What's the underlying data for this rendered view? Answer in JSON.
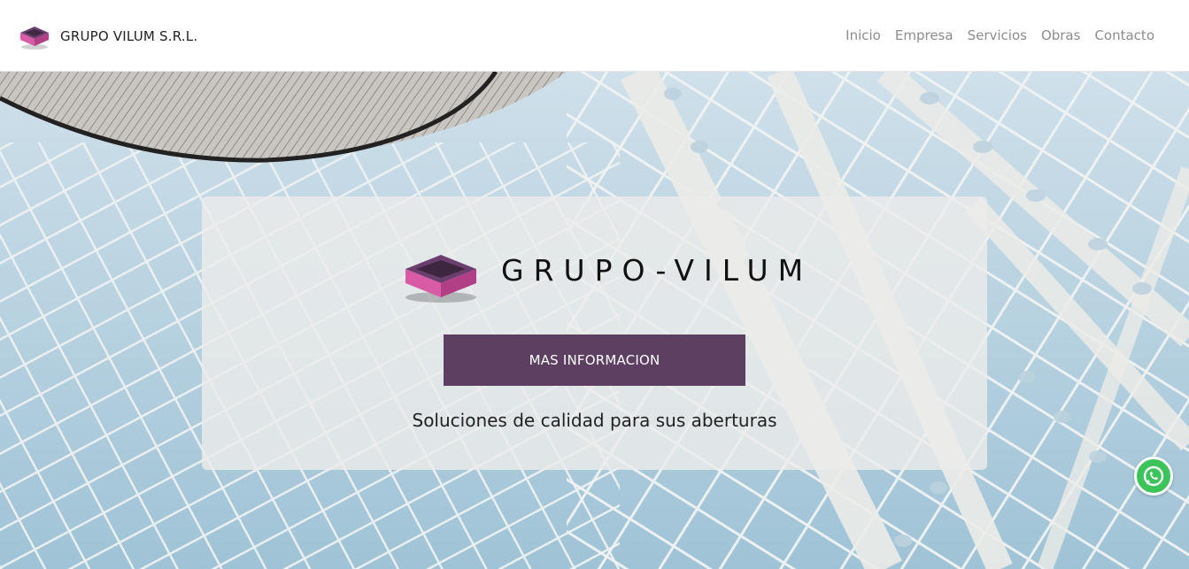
{
  "header": {
    "brand_name": "GRUPO VILUM S.R.L.",
    "nav": [
      "Inicio",
      "Empresa",
      "Servicios",
      "Obras",
      "Contacto"
    ]
  },
  "hero": {
    "title": "GRUPO-VILUM",
    "cta_label": "MAS INFORMACION",
    "tagline": "Soluciones de calidad para sus aberturas"
  },
  "colors": {
    "accent": "#5c3f61",
    "logo_pink": "#d95ba6",
    "logo_purple": "#6a3f6e",
    "whatsapp": "#3cc35a"
  },
  "icons": {
    "brand": "box-logo-icon",
    "whatsapp": "whatsapp-icon"
  }
}
